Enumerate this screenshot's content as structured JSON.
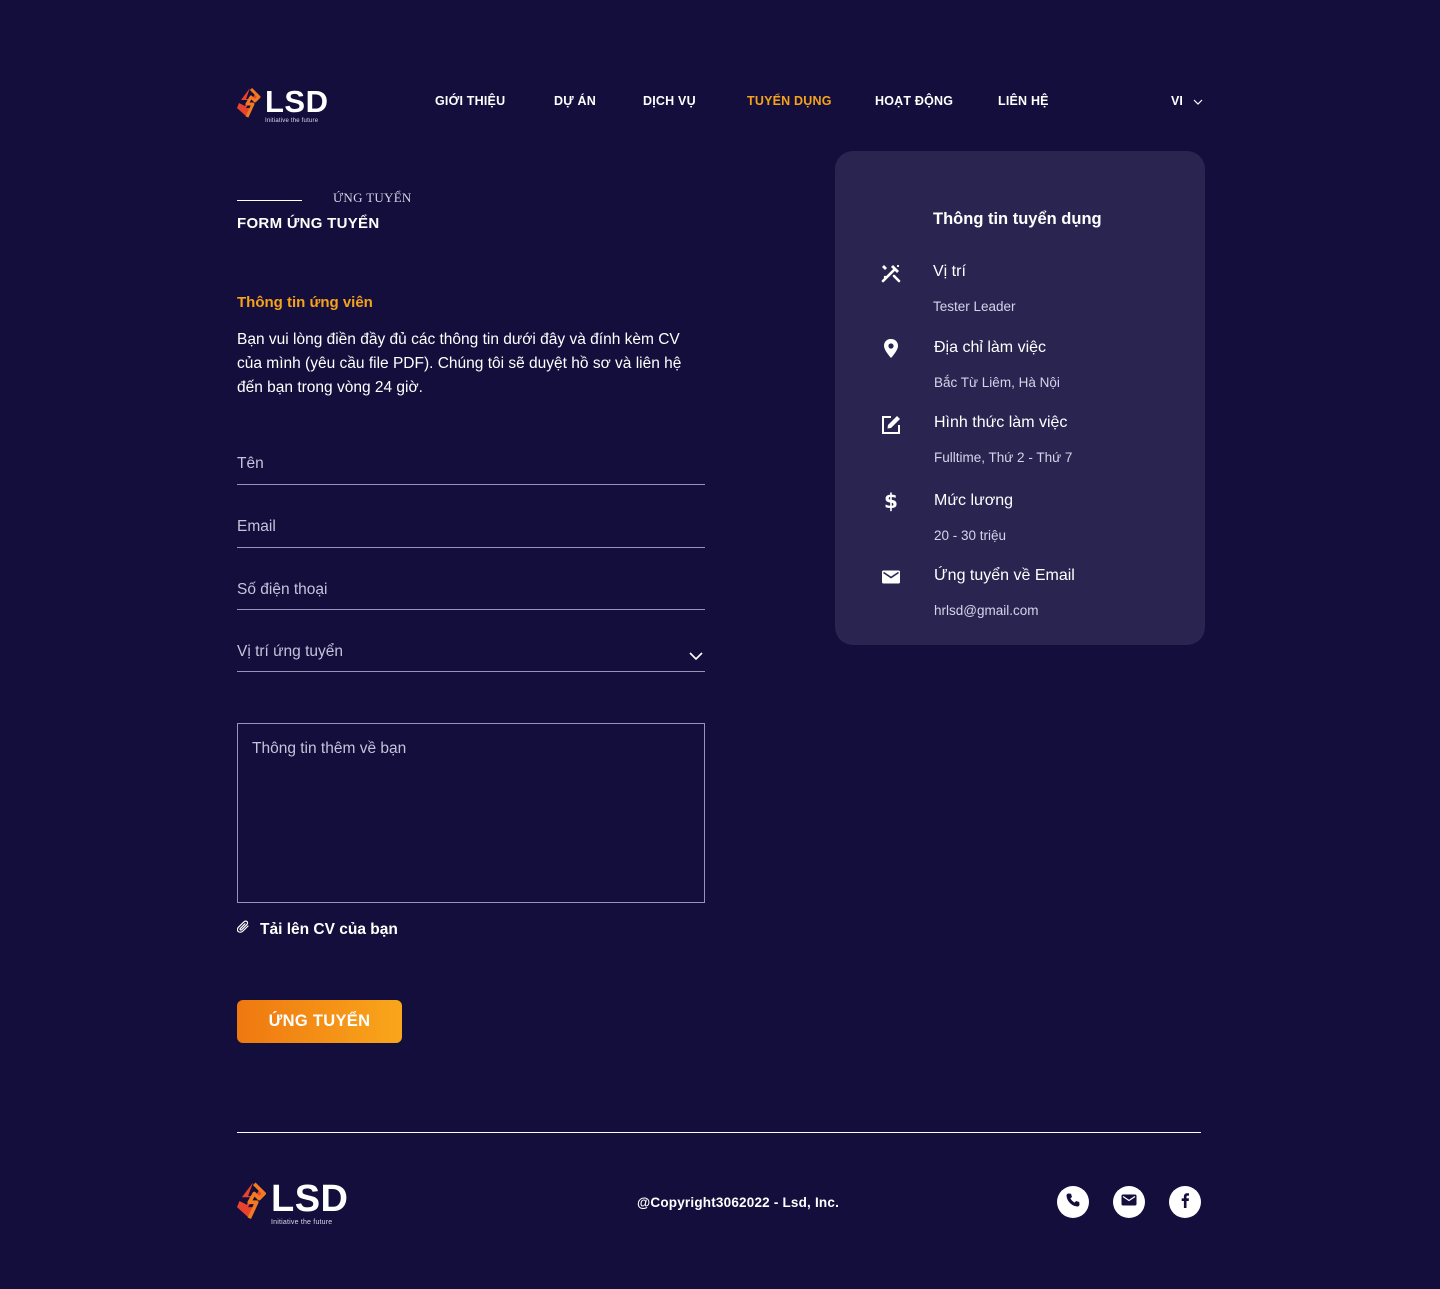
{
  "brand": {
    "name": "LSD",
    "tagline": "Initiative the future"
  },
  "nav": {
    "items": [
      {
        "label": "GIỚI THIỆU",
        "active": false
      },
      {
        "label": "DỰ ÁN",
        "active": false
      },
      {
        "label": "DỊCH VỤ",
        "active": false
      },
      {
        "label": "TUYỂN DỤNG",
        "active": true
      },
      {
        "label": "HOẠT ĐỘNG",
        "active": false
      },
      {
        "label": "LIÊN HỆ",
        "active": false
      }
    ],
    "language": "VI"
  },
  "breadcrumb": {
    "small": "ỨNG TUYỂN",
    "title": "FORM ỨNG TUYỂN"
  },
  "form": {
    "section_title": "Thông tin ứng viên",
    "intro": "Bạn vui lòng điền đầy đủ các thông tin dưới đây và đính kèm CV của mình (yêu cầu file PDF). Chúng tôi sẽ duyệt hồ sơ và liên hệ đến bạn trong vòng 24 giờ.",
    "name_placeholder": "Tên",
    "email_placeholder": "Email",
    "phone_placeholder": "Số điện thoại",
    "position_placeholder": "Vị trí ứng tuyển",
    "about_placeholder": "Thông tin thêm về bạn",
    "upload_label": "Tải lên CV của bạn",
    "submit_label": "ỨNG TUYỂN"
  },
  "job_info": {
    "title": "Thông tin tuyển dụng",
    "items": [
      {
        "icon": "tools-icon",
        "label": "Vị trí",
        "value": "Tester Leader"
      },
      {
        "icon": "location-pin-icon",
        "label": "Địa chỉ làm việc",
        "value": "Bắc Từ Liêm, Hà Nội"
      },
      {
        "icon": "edit-icon",
        "label": "Hình thức làm việc",
        "value": "Fulltime, Thứ 2 - Thứ 7"
      },
      {
        "icon": "dollar-icon",
        "label": "Mức lương",
        "value": "20 - 30 triệu"
      },
      {
        "icon": "mail-icon",
        "label": "Ứng tuyển về Email",
        "value": "hrlsd@gmail.com"
      }
    ]
  },
  "footer": {
    "copyright": "@Copyright3062022 - Lsd, Inc.",
    "social": [
      "phone-icon",
      "mail-icon",
      "facebook-icon"
    ]
  },
  "colors": {
    "background": "#130e3b",
    "card": "#2a2450",
    "accent": "#f7a21b",
    "button_start": "#ef7811",
    "button_end": "#f9a61b",
    "logo_red": "#e8432c"
  }
}
